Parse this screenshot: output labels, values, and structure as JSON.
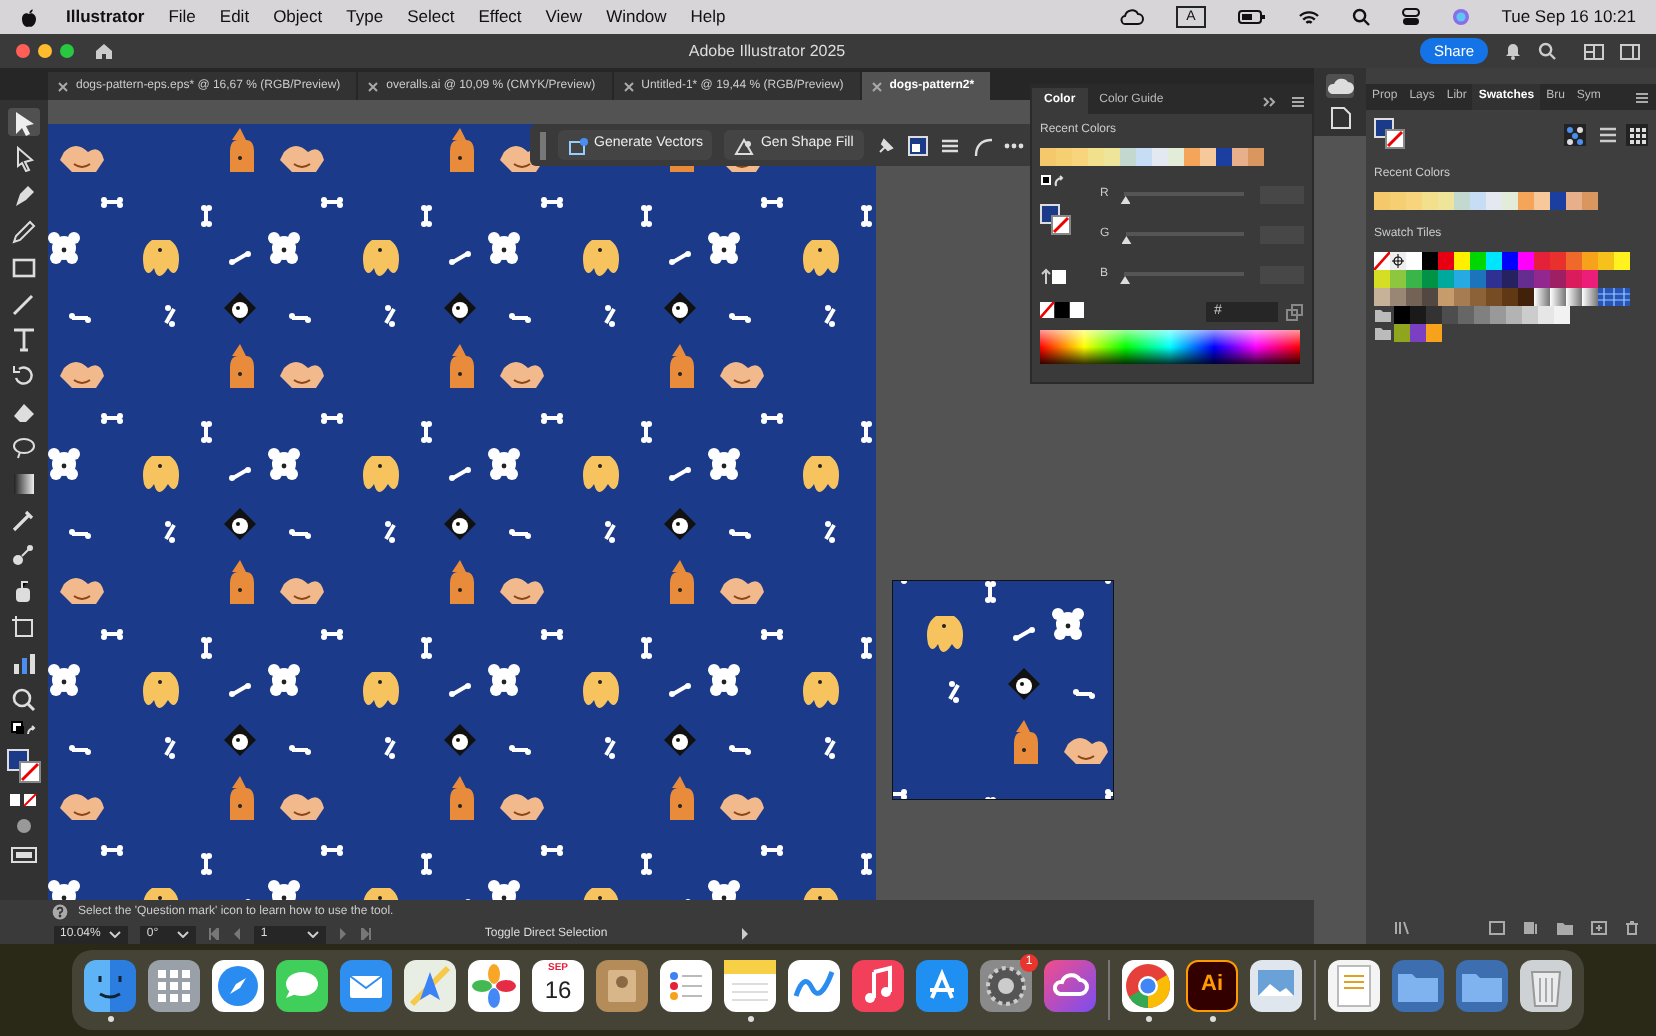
{
  "menu_bar": {
    "app": "Illustrator",
    "items": [
      "File",
      "Edit",
      "Object",
      "Type",
      "Select",
      "Effect",
      "View",
      "Window",
      "Help"
    ],
    "input_source": "A",
    "clock": "Tue Sep 16  10:21"
  },
  "title_bar": {
    "title": "Adobe Illustrator 2025",
    "share": "Share"
  },
  "doc_tabs": [
    {
      "label": "dogs-pattern-eps.eps* @ 16,67 % (RGB/Preview)",
      "selected": false
    },
    {
      "label": "overalls.ai @ 10,09 % (CMYK/Preview)",
      "selected": false
    },
    {
      "label": "Untitled-1* @ 19,44 % (RGB/Preview)",
      "selected": false
    },
    {
      "label": "dogs-pattern2*",
      "selected": true
    }
  ],
  "context_bar": {
    "buttons": [
      "Generate Vectors",
      "Gen Shape Fill"
    ]
  },
  "color_panel": {
    "tabs": [
      {
        "label": "Color",
        "selected": true
      },
      {
        "label": "Color Guide",
        "selected": false
      }
    ],
    "recent_label": "Recent Colors",
    "recent_colors": [
      {
        "color": "#f5c96b"
      },
      {
        "color": "#f7cf73"
      },
      {
        "color": "#f8d47c"
      },
      {
        "color": "#f3e08d"
      },
      {
        "color": "#efe59a"
      },
      {
        "color": "#c3d8cf"
      },
      {
        "color": "#c7dcf5"
      },
      {
        "color": "#e4e9f1"
      },
      {
        "color": "#e2ecd8"
      },
      {
        "color": "#f5a55a"
      },
      {
        "color": "#f7c899"
      },
      {
        "color": "#1b3fa0"
      },
      {
        "color": "#e8b08a"
      },
      {
        "color": "#d9965e"
      }
    ],
    "channels": [
      {
        "label": "R",
        "level": 0
      },
      {
        "label": "G",
        "level": 0
      },
      {
        "label": "B",
        "level": 0
      }
    ],
    "hex_label": "#"
  },
  "swatches_panel": {
    "tabs": [
      {
        "label": "Prop",
        "selected": false
      },
      {
        "label": "Lays",
        "selected": false
      },
      {
        "label": "Libr",
        "selected": false
      },
      {
        "label": "Swatches",
        "selected": true
      },
      {
        "label": "Bru",
        "selected": false
      },
      {
        "label": "Sym",
        "selected": false
      }
    ],
    "recent_label": "Recent Colors",
    "recent_colors": [
      {
        "color": "#f5c96b"
      },
      {
        "color": "#f7cf73"
      },
      {
        "color": "#f8d47c"
      },
      {
        "color": "#f3e08d"
      },
      {
        "color": "#efe59a"
      },
      {
        "color": "#c3d8cf"
      },
      {
        "color": "#c7dcf5"
      },
      {
        "color": "#e4e9f1"
      },
      {
        "color": "#e2ecd8"
      },
      {
        "color": "#f5a55a"
      },
      {
        "color": "#f7c899"
      },
      {
        "color": "#1b3fa0"
      },
      {
        "color": "#e8b08a"
      },
      {
        "color": "#d9965e"
      }
    ],
    "tiles_label": "Swatch Tiles",
    "tile_rows": [
      [
        {
          "kind": "none"
        },
        {
          "kind": "registration"
        },
        {
          "kind": "color",
          "color": "#ffffff"
        },
        {
          "kind": "color",
          "color": "#000000"
        },
        {
          "kind": "color",
          "color": "#e60012"
        },
        {
          "kind": "color",
          "color": "#fff000"
        },
        {
          "kind": "color",
          "color": "#00d600"
        },
        {
          "kind": "color",
          "color": "#00e5ff"
        },
        {
          "kind": "color",
          "color": "#0000ff"
        },
        {
          "kind": "color",
          "color": "#ff00ff"
        },
        {
          "kind": "color",
          "color": "#e5213a"
        },
        {
          "kind": "color",
          "color": "#e8302c"
        },
        {
          "kind": "color",
          "color": "#ef6a2a"
        },
        {
          "kind": "color",
          "color": "#f7a21b"
        },
        {
          "kind": "color",
          "color": "#f7c11b"
        },
        {
          "kind": "color",
          "color": "#fff21f"
        }
      ],
      [
        {
          "kind": "color",
          "color": "#d6de23"
        },
        {
          "kind": "color",
          "color": "#8dc63f"
        },
        {
          "kind": "color",
          "color": "#39b54a"
        },
        {
          "kind": "color",
          "color": "#009245"
        },
        {
          "kind": "color",
          "color": "#00a99d"
        },
        {
          "kind": "color",
          "color": "#27aae1"
        },
        {
          "kind": "color",
          "color": "#1c75bc"
        },
        {
          "kind": "color",
          "color": "#2e3192"
        },
        {
          "kind": "color",
          "color": "#262262"
        },
        {
          "kind": "color",
          "color": "#662d91"
        },
        {
          "kind": "color",
          "color": "#92278f"
        },
        {
          "kind": "color",
          "color": "#9e1f63"
        },
        {
          "kind": "color",
          "color": "#da1c5c"
        },
        {
          "kind": "color",
          "color": "#ed1e79"
        }
      ],
      [
        {
          "kind": "color",
          "color": "#c7b299"
        },
        {
          "kind": "color",
          "color": "#998675"
        },
        {
          "kind": "color",
          "color": "#736357"
        },
        {
          "kind": "color",
          "color": "#534741"
        },
        {
          "kind": "color",
          "color": "#c69c6d"
        },
        {
          "kind": "color",
          "color": "#a67c52"
        },
        {
          "kind": "color",
          "color": "#8c6239"
        },
        {
          "kind": "color",
          "color": "#754c24"
        },
        {
          "kind": "color",
          "color": "#603813"
        },
        {
          "kind": "color",
          "color": "#42210b"
        },
        {
          "kind": "gradient"
        },
        {
          "kind": "gradient"
        },
        {
          "kind": "gradient"
        },
        {
          "kind": "gradient"
        },
        {
          "kind": "pattern"
        }
      ],
      [
        {
          "kind": "folder"
        },
        {
          "kind": "color",
          "color": "#000000"
        },
        {
          "kind": "color",
          "color": "#1a1a1a"
        },
        {
          "kind": "color",
          "color": "#333333"
        },
        {
          "kind": "color",
          "color": "#4d4d4d"
        },
        {
          "kind": "color",
          "color": "#666666"
        },
        {
          "kind": "color",
          "color": "#808080"
        },
        {
          "kind": "color",
          "color": "#999999"
        },
        {
          "kind": "color",
          "color": "#b3b3b3"
        },
        {
          "kind": "color",
          "color": "#cccccc"
        },
        {
          "kind": "color",
          "color": "#e6e6e6"
        },
        {
          "kind": "color",
          "color": "#f2f2f2"
        }
      ],
      [
        {
          "kind": "folder"
        },
        {
          "kind": "color",
          "color": "#8fa51e"
        },
        {
          "kind": "color",
          "color": "#7b3fc4"
        },
        {
          "kind": "color",
          "color": "#f7a21b"
        }
      ]
    ]
  },
  "status_bar": {
    "hint": "Select the 'Question mark' icon to learn how to use the tool.",
    "zoom": "10.04%",
    "rotation": "0°",
    "artboard": "1",
    "tool_hint": "Toggle Direct Selection"
  },
  "dock": {
    "items": [
      {
        "kind": "finder",
        "running": true
      },
      {
        "kind": "launchpad",
        "running": false
      },
      {
        "kind": "safari",
        "running": false
      },
      {
        "kind": "messages",
        "running": false
      },
      {
        "kind": "mail",
        "running": false
      },
      {
        "kind": "maps",
        "running": false
      },
      {
        "kind": "photos",
        "running": false
      },
      {
        "kind": "calendar",
        "running": false,
        "month": "SEP",
        "day": "16"
      },
      {
        "kind": "contacts",
        "running": false
      },
      {
        "kind": "reminders",
        "running": false
      },
      {
        "kind": "notes",
        "running": true
      },
      {
        "kind": "freeform",
        "running": false
      },
      {
        "kind": "music",
        "running": false
      },
      {
        "kind": "appstore",
        "running": false
      },
      {
        "kind": "settings",
        "running": false,
        "badge": "1"
      },
      {
        "kind": "creativecloud",
        "running": false
      },
      {
        "kind": "divider"
      },
      {
        "kind": "chrome",
        "running": true
      },
      {
        "kind": "illustrator",
        "running": true,
        "label": "Ai"
      },
      {
        "kind": "preview",
        "running": false
      },
      {
        "kind": "divider"
      },
      {
        "kind": "document",
        "running": false
      },
      {
        "kind": "folder",
        "running": false
      },
      {
        "kind": "folder",
        "running": false
      },
      {
        "kind": "trash",
        "running": false
      }
    ]
  }
}
